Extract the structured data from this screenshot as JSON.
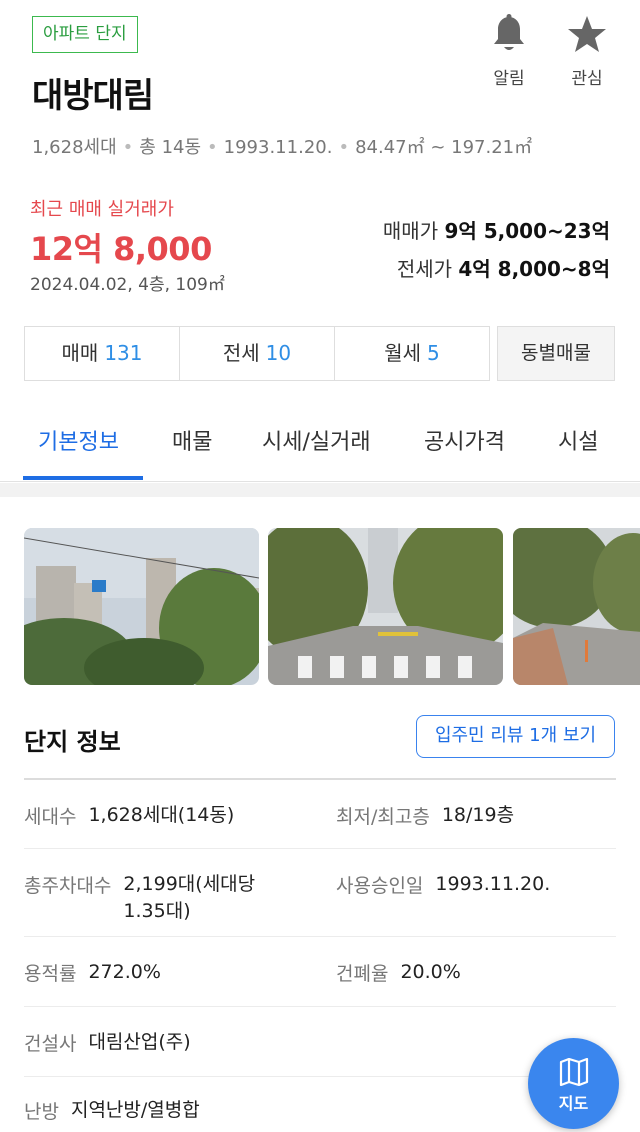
{
  "header": {
    "tag": "아파트 단지",
    "title": "대방대림",
    "actions": [
      {
        "label": "알림",
        "icon": "bell-icon"
      },
      {
        "label": "관심",
        "icon": "star-icon"
      }
    ]
  },
  "summary": {
    "households": "1,628세대",
    "buildings": "총 14동",
    "approval_date": "1993.11.20.",
    "area_range": "84.47㎡ ~ 197.21㎡"
  },
  "recent_trade": {
    "label": "최근 매매 실거래가",
    "price": "12억 8,000",
    "detail": "2024.04.02, 4층, 109㎡"
  },
  "price_range": {
    "sale_label": "매매가",
    "sale_value": "9억 5,000~23억",
    "lease_label": "전세가",
    "lease_value": "4억 8,000~8억"
  },
  "listing_tabs": [
    {
      "label": "매매",
      "count": "131"
    },
    {
      "label": "전세",
      "count": "10"
    },
    {
      "label": "월세",
      "count": "5"
    }
  ],
  "building_listing_button": "동별매물",
  "nav_tabs": [
    "기본정보",
    "매물",
    "시세/실거래",
    "공시가격",
    "시설"
  ],
  "active_nav_tab": "기본정보",
  "complex_info": {
    "title": "단지 정보",
    "review_button": "입주민 리뷰 1개 보기",
    "rows": [
      [
        {
          "key": "세대수",
          "value": "1,628세대(14동)"
        },
        {
          "key": "최저/최고층",
          "value": "18/19층"
        }
      ],
      [
        {
          "key": "총주차대수",
          "value": "2,199대(세대당 1.35대)"
        },
        {
          "key": "사용승인일",
          "value": "1993.11.20."
        }
      ],
      [
        {
          "key": "용적률",
          "value": "272.0%"
        },
        {
          "key": "건폐율",
          "value": "20.0%"
        }
      ],
      [
        {
          "key": "건설사",
          "value": "대림산업(주)"
        }
      ],
      [
        {
          "key": "난방",
          "value": "지역난방/열병합"
        }
      ]
    ]
  },
  "map_button": {
    "label": "지도",
    "icon": "map-icon"
  },
  "colors": {
    "accent_blue": "#1e6de4",
    "price_red": "#e5484d",
    "tag_green": "#3cb94e",
    "fab_blue": "#3a86ee"
  }
}
